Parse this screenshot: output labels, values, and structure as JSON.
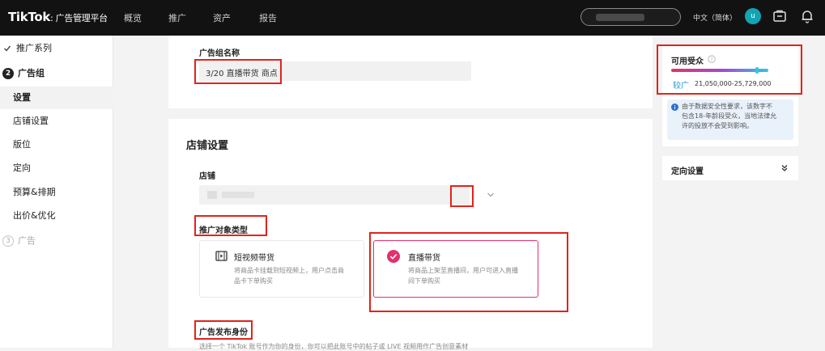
{
  "brand": {
    "name": "TikTok",
    "sub": ": 广告管理平台"
  },
  "nav": [
    "概览",
    "推广",
    "资产",
    "报告"
  ],
  "header": {
    "language": "中文（简体）",
    "avatar_letter": "u"
  },
  "sidebar": {
    "campaign": "推广系列",
    "adgroup_step": "2",
    "adgroup": "广告组",
    "items": [
      "设置",
      "店铺设置",
      "版位",
      "定向",
      "预算&排期",
      "出价&优化"
    ],
    "ad_step": "3",
    "ad": "广告"
  },
  "adgroup_name": {
    "label": "广告组名称",
    "value": "3/20 直播带货 商点"
  },
  "shop_settings": {
    "title": "店铺设置",
    "shop_label": "店铺",
    "promo_type_label": "推广对象类型",
    "options": [
      {
        "title": "短视频带货",
        "desc_line1": "将商品卡挂载到短视频上，用户点击商",
        "desc_line2": "品卡下单购买"
      },
      {
        "title": "直播带货",
        "desc_line1": "将商品上架至直播间，用户可进入直播",
        "desc_line2": "间下单购买"
      }
    ],
    "identity_label": "广告发布身份",
    "identity_desc": "选择一个 TikTok 账号作为你的身份，你可以把此账号中的帖子或 LIVE 视频用作广告创意素材"
  },
  "audience": {
    "title": "可用受众",
    "level": "较广",
    "range": "21,050,000-25,729,000",
    "level_fraction": 0.88,
    "info_line1": "由于数据安全性要求，该数字不",
    "info_line2": "包含18-年龄段受众，当地法律允",
    "info_line3": "许的投放不会受到影响。"
  },
  "targeting": {
    "title": "定向设置"
  },
  "colors": {
    "accent": "#e4306a",
    "annotation": "#e2231a",
    "avatar": "#12a4b5",
    "topbar": "#121212"
  }
}
